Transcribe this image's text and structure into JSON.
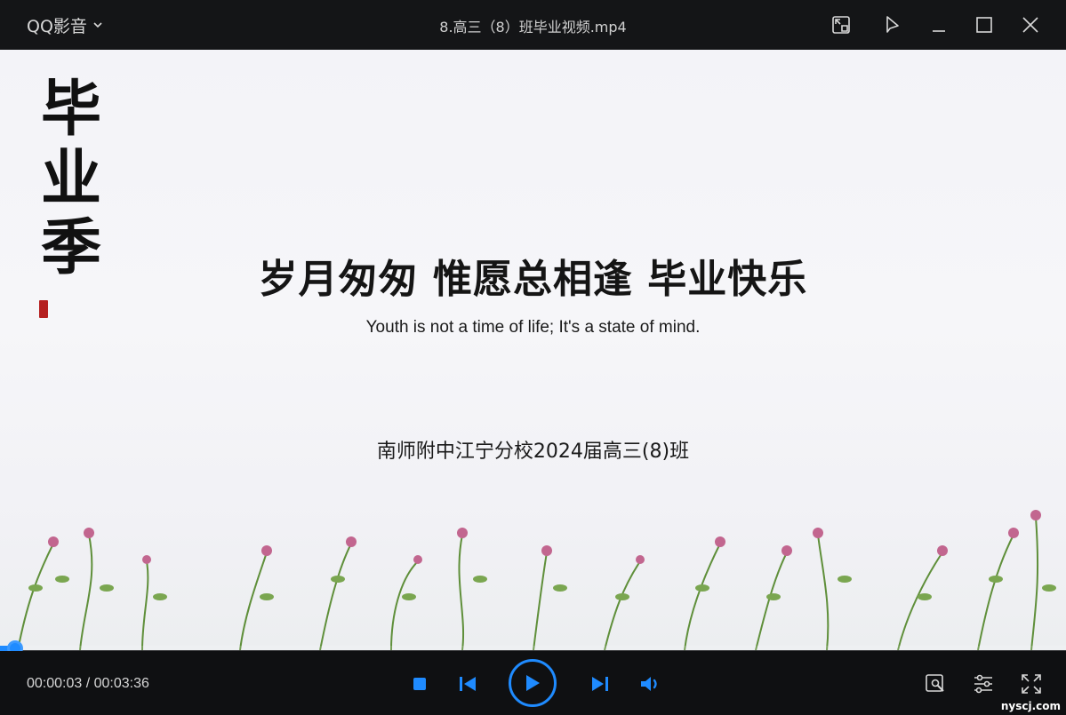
{
  "titlebar": {
    "app_name": "QQ影音",
    "file_title": "8.高三（8）班毕业视频.mp4",
    "buttons": [
      "mini-mode-icon",
      "pin-icon",
      "minimize-icon",
      "maximize-icon",
      "close-icon"
    ]
  },
  "video": {
    "calligraphy": [
      "毕",
      "业",
      "季"
    ],
    "main_title": "岁月匆匆 惟愿总相逢 毕业快乐",
    "subtitle_en": "Youth is not a time of life; It's a state of mind.",
    "school": "南师附中江宁分校2024届高三(8)班"
  },
  "player": {
    "current_time": "00:00:03",
    "total_time": "00:03:36",
    "time_display": "00:00:03 / 00:03:36",
    "progress_fraction": 0.014,
    "accent_color": "#1f8bff",
    "controls": [
      "stop-icon",
      "previous-icon",
      "play-icon",
      "next-icon",
      "volume-icon"
    ],
    "right_controls": [
      "screenshot-tool-icon",
      "settings-sliders-icon",
      "fullscreen-icon"
    ]
  },
  "watermark": "nyscj.com"
}
